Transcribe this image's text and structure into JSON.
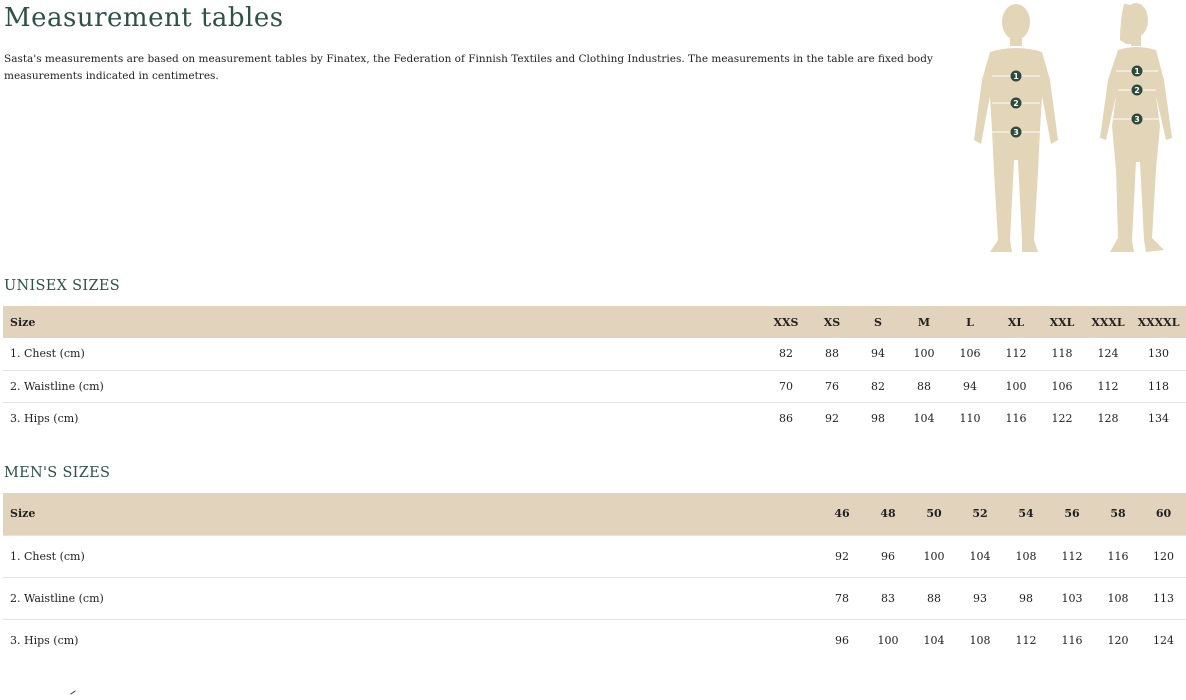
{
  "page": {
    "title": "Measurement tables",
    "intro": "Sasta's measurements are based on measurement tables by Finatex, the Federation of Finnish Textiles and Clothing Industries. The measurements in the table are fixed body measurements indicated in centimetres."
  },
  "figures": {
    "male_markers": [
      "1",
      "2",
      "3"
    ],
    "female_markers": [
      "1",
      "2",
      "3"
    ]
  },
  "unisex": {
    "title": "UNISEX SIZES",
    "header_label": "Size",
    "sizes": [
      "XXS",
      "XS",
      "S",
      "M",
      "L",
      "XL",
      "XXL",
      "XXXL",
      "XXXXL"
    ],
    "rows": [
      {
        "label": "1. Chest (cm)",
        "values": [
          "82",
          "88",
          "94",
          "100",
          "106",
          "112",
          "118",
          "124",
          "130"
        ]
      },
      {
        "label": "2. Waistline (cm)",
        "values": [
          "70",
          "76",
          "82",
          "88",
          "94",
          "100",
          "106",
          "112",
          "118"
        ]
      },
      {
        "label": "3. Hips (cm)",
        "values": [
          "86",
          "92",
          "98",
          "104",
          "110",
          "116",
          "122",
          "128",
          "134"
        ]
      }
    ]
  },
  "mens": {
    "title": "MEN'S SIZES",
    "header_label": "Size",
    "sizes": [
      "46",
      "48",
      "50",
      "52",
      "54",
      "56",
      "58",
      "60"
    ],
    "rows": [
      {
        "label": "1. Chest (cm)",
        "values": [
          "92",
          "96",
          "100",
          "104",
          "108",
          "112",
          "116",
          "120"
        ]
      },
      {
        "label": "2. Waistline (cm)",
        "values": [
          "78",
          "83",
          "88",
          "93",
          "98",
          "103",
          "108",
          "113"
        ]
      },
      {
        "label": "3. Hips (cm)",
        "values": [
          "96",
          "100",
          "104",
          "108",
          "112",
          "116",
          "120",
          "124"
        ]
      }
    ]
  },
  "colors": {
    "title_green": "#2f5248",
    "header_beige": "#e2d4bc",
    "figure_beige": "#e3d5b8",
    "marker_dark": "#2c4a3e"
  }
}
